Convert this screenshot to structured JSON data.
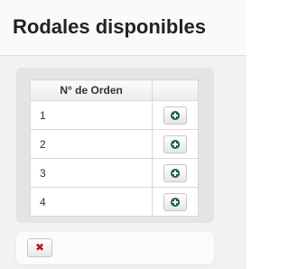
{
  "header": {
    "title": "Rodales disponibles"
  },
  "table": {
    "columns": [
      "N° de Orden",
      ""
    ],
    "rows": [
      {
        "order": "1",
        "action_icon": "plus-circle-icon"
      },
      {
        "order": "2",
        "action_icon": "plus-circle-icon"
      },
      {
        "order": "3",
        "action_icon": "plus-circle-icon"
      },
      {
        "order": "4",
        "action_icon": "plus-circle-icon"
      }
    ]
  },
  "footer": {
    "close_icon": "close-icon",
    "close_glyph": "✖"
  },
  "colors": {
    "add_icon": "#1e5f45",
    "close_icon": "#b31b1b"
  }
}
